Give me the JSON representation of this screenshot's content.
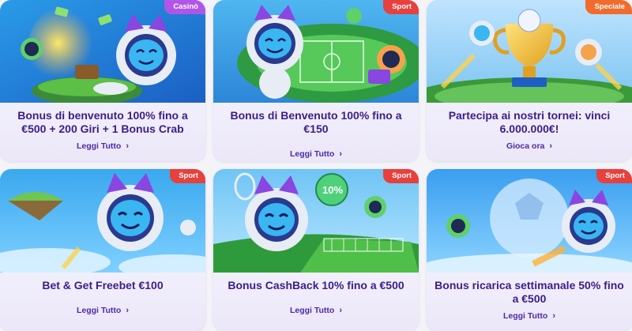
{
  "colors": {
    "badge_casino": "#b055e8",
    "badge_sport": "#e8403c",
    "badge_speciale": "#f26b2c",
    "title": "#3a1f86",
    "link": "#4b2aa8"
  },
  "cards": [
    {
      "badge": "Casinò",
      "title": "Bonus di benvenuto 100% fino a €500 + 200 Giri + 1 Bonus Crab",
      "link": "Leggi Tutto",
      "art": "cat-astronaut-casino-illustration"
    },
    {
      "badge": "Sport",
      "title": "Bonus di Benvenuto 100% fino a €150",
      "link": "Leggi Tutto",
      "art": "cat-astronaut-stadium-illustration"
    },
    {
      "badge": "Speciale",
      "title": "Partecipa ai nostri tornei: vinci 6.000.000€!",
      "link": "Gioca ora",
      "art": "trophy-illustration"
    },
    {
      "badge": "Sport",
      "title": "Bet & Get Freebet €100",
      "link": "Leggi Tutto",
      "art": "cat-astronaut-floating-island-illustration"
    },
    {
      "badge": "Sport",
      "title": "Bonus CashBack 10% fino a €500",
      "link": "Leggi Tutto",
      "art": "cat-astronaut-tennis-illustration",
      "chip": "10%"
    },
    {
      "badge": "Sport",
      "title": "Bonus ricarica settimanale 50% fino a €500",
      "link": "Leggi Tutto",
      "art": "cat-astronaut-football-illustration"
    }
  ],
  "link_icon": "chevron-right-icon"
}
